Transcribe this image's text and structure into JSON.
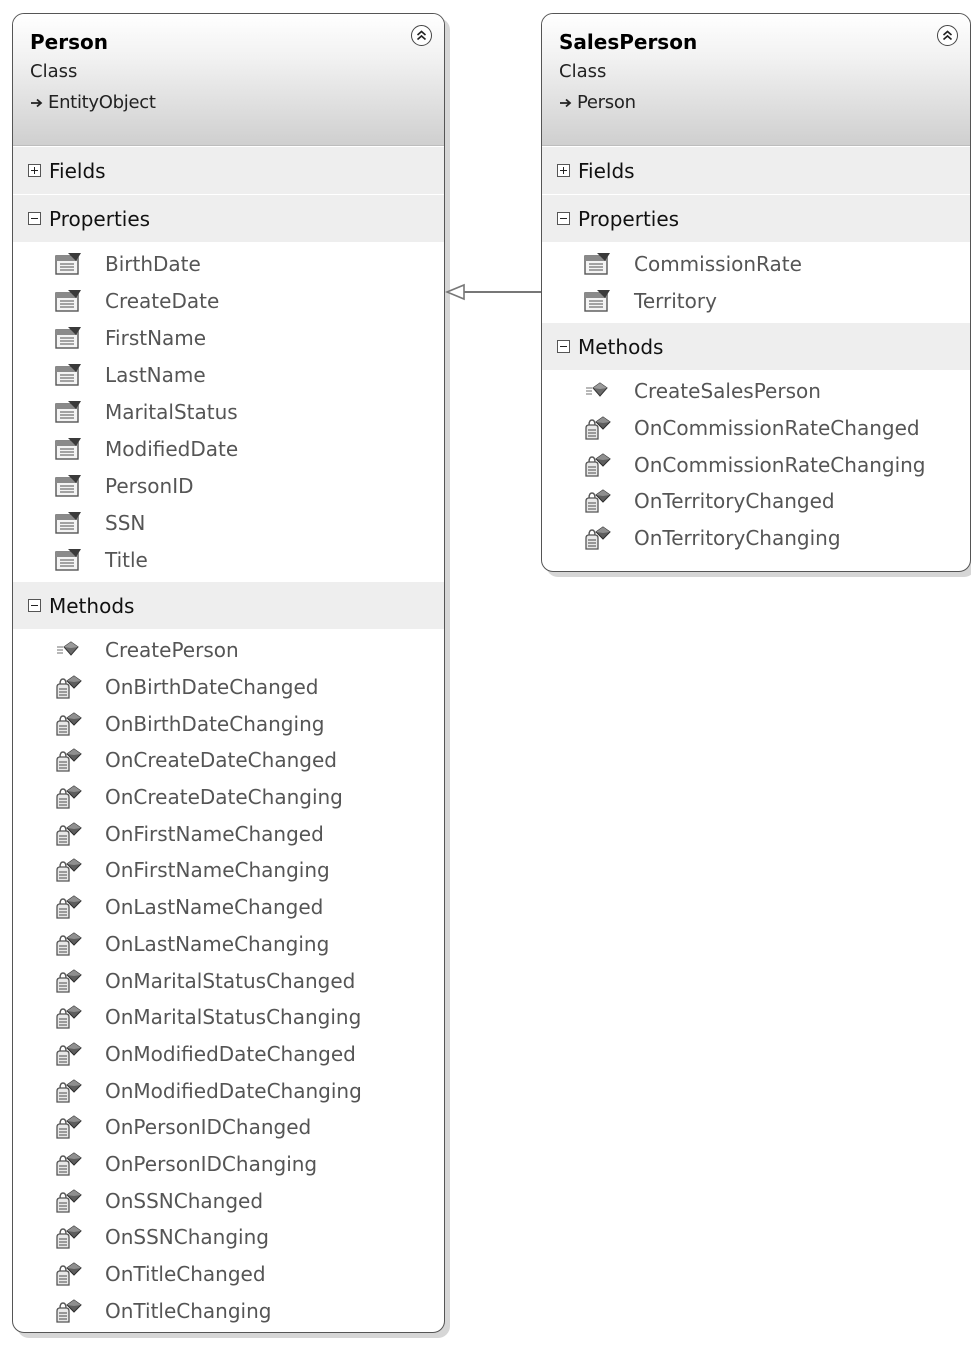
{
  "classes": {
    "person": {
      "name": "Person",
      "kind": "Class",
      "base": "EntityObject",
      "sections": {
        "fields": "Fields",
        "properties": "Properties",
        "methods": "Methods"
      },
      "properties": [
        "BirthDate",
        "CreateDate",
        "FirstName",
        "LastName",
        "MaritalStatus",
        "ModifiedDate",
        "PersonID",
        "SSN",
        "Title"
      ],
      "methods": [
        {
          "name": "CreatePerson",
          "icon": "public-static-method-icon"
        },
        {
          "name": "OnBirthDateChanged",
          "icon": "partial-method-icon"
        },
        {
          "name": "OnBirthDateChanging",
          "icon": "partial-method-icon"
        },
        {
          "name": "OnCreateDateChanged",
          "icon": "partial-method-icon"
        },
        {
          "name": "OnCreateDateChanging",
          "icon": "partial-method-icon"
        },
        {
          "name": "OnFirstNameChanged",
          "icon": "partial-method-icon"
        },
        {
          "name": "OnFirstNameChanging",
          "icon": "partial-method-icon"
        },
        {
          "name": "OnLastNameChanged",
          "icon": "partial-method-icon"
        },
        {
          "name": "OnLastNameChanging",
          "icon": "partial-method-icon"
        },
        {
          "name": "OnMaritalStatusChanged",
          "icon": "partial-method-icon"
        },
        {
          "name": "OnMaritalStatusChanging",
          "icon": "partial-method-icon"
        },
        {
          "name": "OnModifiedDateChanged",
          "icon": "partial-method-icon"
        },
        {
          "name": "OnModifiedDateChanging",
          "icon": "partial-method-icon"
        },
        {
          "name": "OnPersonIDChanged",
          "icon": "partial-method-icon"
        },
        {
          "name": "OnPersonIDChanging",
          "icon": "partial-method-icon"
        },
        {
          "name": "OnSSNChanged",
          "icon": "partial-method-icon"
        },
        {
          "name": "OnSSNChanging",
          "icon": "partial-method-icon"
        },
        {
          "name": "OnTitleChanged",
          "icon": "partial-method-icon"
        },
        {
          "name": "OnTitleChanging",
          "icon": "partial-method-icon"
        }
      ]
    },
    "salesperson": {
      "name": "SalesPerson",
      "kind": "Class",
      "base": "Person",
      "sections": {
        "fields": "Fields",
        "properties": "Properties",
        "methods": "Methods"
      },
      "properties": [
        "CommissionRate",
        "Territory"
      ],
      "methods": [
        {
          "name": "CreateSalesPerson",
          "icon": "public-static-method-icon"
        },
        {
          "name": "OnCommissionRateChanged",
          "icon": "partial-method-icon"
        },
        {
          "name": "OnCommissionRateChanging",
          "icon": "partial-method-icon"
        },
        {
          "name": "OnTerritoryChanged",
          "icon": "partial-method-icon"
        },
        {
          "name": "OnTerritoryChanging",
          "icon": "partial-method-icon"
        }
      ]
    }
  },
  "icons": {
    "collapse": "double-chevron-up-icon",
    "inherits": "inheritance-arrow-icon",
    "property": "property-icon",
    "expand": "plus-box-icon",
    "collapse_section": "minus-box-icon"
  },
  "colors": {
    "header_gradient_end": "#cfcfcf",
    "section_header": "#eeeeee",
    "border": "#555555",
    "member_text": "#555555",
    "method_gem": "#6a6a6a"
  },
  "relationships": [
    {
      "from": "SalesPerson",
      "to": "Person",
      "type": "inheritance"
    }
  ]
}
